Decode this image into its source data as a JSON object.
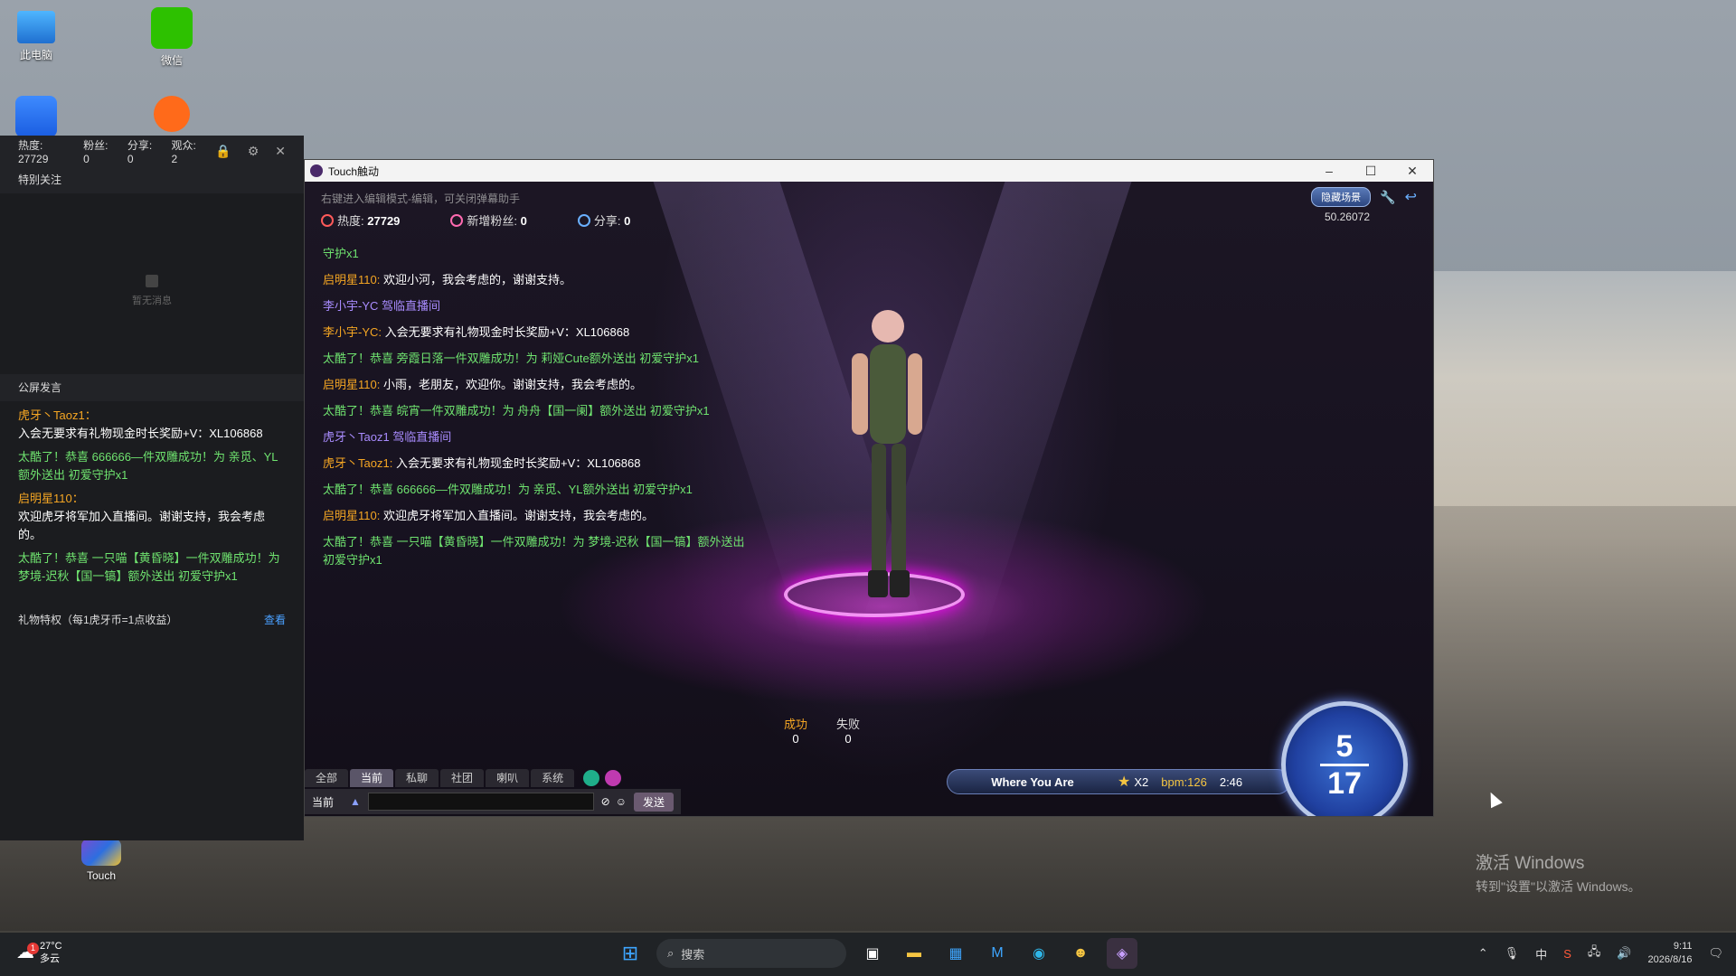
{
  "desktop": {
    "icons": [
      {
        "label": "此电脑"
      },
      {
        "label": "微信"
      },
      {
        "label": ""
      },
      {
        "label": ""
      },
      {
        "label": "Touch"
      }
    ],
    "activation": {
      "line1": "激活 Windows",
      "line2": "转到\"设置\"以激活 Windows。"
    }
  },
  "left_panel": {
    "stats": {
      "heat_label": "热度:",
      "heat": "27729",
      "fans_label": "粉丝:",
      "fans": "0",
      "share_label": "分享:",
      "share": "0",
      "viewers_label": "观众:",
      "viewers": "2"
    },
    "special_title": "特别关注",
    "empty_text": "暂无消息",
    "public_title": "公屏发言",
    "messages": [
      {
        "name": "虎牙丶Taoz1：",
        "text": "入会无要求有礼物现金时长奖励+V：XL106868"
      },
      {
        "name": "",
        "text": "太酷了！恭喜 666666—件双雕成功！为 亲觅、YL额外送出 初爱守护x1"
      },
      {
        "name": "启明星110：",
        "text": "欢迎虎牙将军加入直播间。谢谢支持，我会考虑的。"
      },
      {
        "name": "",
        "text": "太酷了！恭喜 一只喵【黄昏晓】一件双雕成功！为 梦境-迟秋【国一镐】额外送出 初爱守护x1"
      }
    ],
    "gift_text": "礼物特权（每1虎牙币=1点收益）",
    "gift_more": "查看"
  },
  "window": {
    "title": "Touch触动",
    "hint": "右键进入编辑模式-编辑，可关闭弹幕助手",
    "stats": {
      "heat_label": "热度:",
      "heat": "27729",
      "fans_label": "新增粉丝:",
      "fans": "0",
      "share_label": "分享:",
      "share": "0"
    },
    "hide_scene": "隐藏场景",
    "timer": "50.26072",
    "chat": [
      {
        "type": "sys",
        "text": "守护x1"
      },
      {
        "type": "msg",
        "name": "启明星110:",
        "text": "欢迎小河，我会考虑的，谢谢支持。"
      },
      {
        "type": "enter",
        "text": "李小宇-YC 驾临直播间"
      },
      {
        "type": "msg",
        "name": "李小宇-YC:",
        "text": "入会无要求有礼物现金时长奖励+V：XL106868"
      },
      {
        "type": "sys",
        "text": "太酷了！恭喜 旁霞日落一件双雕成功！为 莉娅Cute额外送出 初爱守护x1"
      },
      {
        "type": "msg",
        "name": "启明星110:",
        "text": "小雨，老朋友，欢迎你。谢谢支持，我会考虑的。"
      },
      {
        "type": "sys",
        "text": "太酷了！恭喜 皖宵一件双雕成功！为 舟舟【国一阑】额外送出 初爱守护x1"
      },
      {
        "type": "enter",
        "text": "虎牙丶Taoz1 驾临直播间"
      },
      {
        "type": "msg",
        "name": "虎牙丶Taoz1:",
        "text": "入会无要求有礼物现金时长奖励+V：XL106868"
      },
      {
        "type": "sys",
        "text": "太酷了！恭喜 666666—件双雕成功！为 亲觅、YL额外送出 初爱守护x1"
      },
      {
        "type": "msg",
        "name": "启明星110:",
        "text": "欢迎虎牙将军加入直播间。谢谢支持，我会考虑的。"
      },
      {
        "type": "sys",
        "text": "太酷了！恭喜 一只喵【黄昏晓】一件双雕成功！为 梦境-迟秋【国一镐】额外送出 初爱守护x1"
      }
    ],
    "result": {
      "success_label": "成功",
      "success": "0",
      "fail_label": "失败",
      "fail": "0"
    },
    "tabs": [
      "全部",
      "当前",
      "私聊",
      "社团",
      "喇叭",
      "系统"
    ],
    "active_tab": 1,
    "input": {
      "channel": "当前",
      "send": "发送"
    },
    "song": {
      "title": "Where You Are",
      "multiplier": "X2",
      "bpm": "bpm:126",
      "time": "2:46"
    },
    "combo": {
      "current": "5",
      "total": "17"
    }
  },
  "taskbar": {
    "weather_temp": "27°C",
    "weather_desc": "多云",
    "weather_badge": "1",
    "search_placeholder": "搜索",
    "time": "9:11",
    "date": "2026/8/16"
  }
}
